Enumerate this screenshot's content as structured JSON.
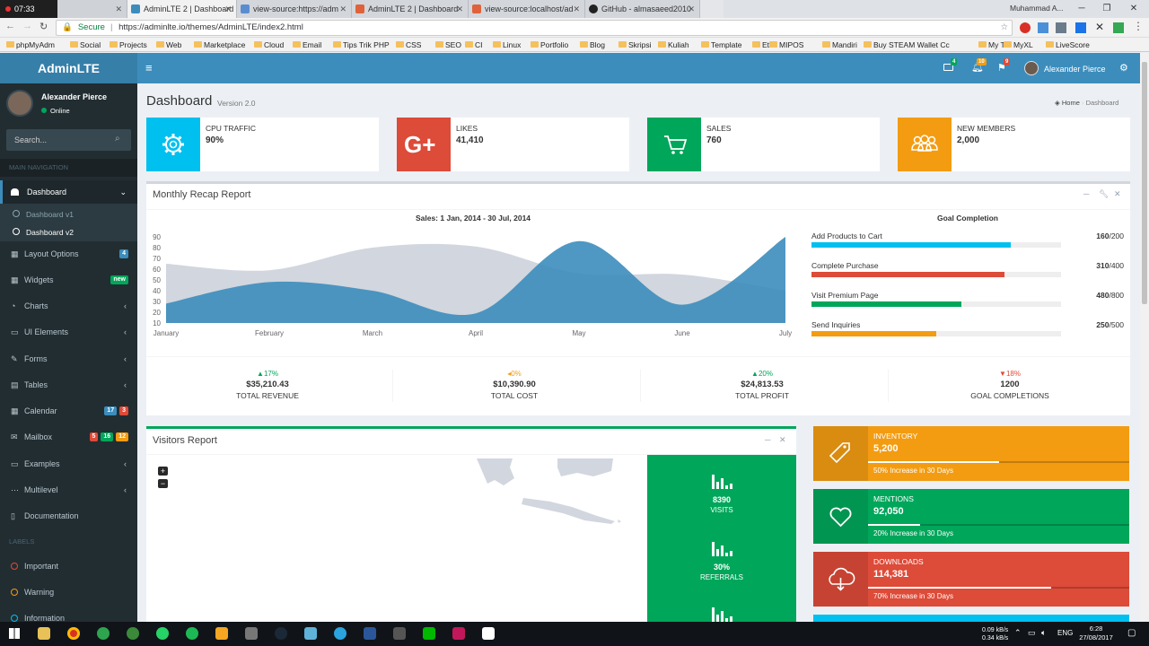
{
  "browser": {
    "clock": "07:33",
    "tabs": [
      {
        "title": "AdminLTE 2 | Dashboard",
        "active": true
      },
      {
        "title": "view-source:https://adm",
        "active": false
      },
      {
        "title": "AdminLTE 2 | Dashboard",
        "active": false
      },
      {
        "title": "view-source:localhost/ad",
        "active": false
      },
      {
        "title": "GitHub - almasaeed2010",
        "active": false
      }
    ],
    "user_chip": "Muhammad A...",
    "secure_label": "Secure",
    "url": "https://adminlte.io/themes/AdminLTE/index2.html",
    "bookmarks": [
      "phpMyAdm",
      "Social",
      "Projects",
      "Web",
      "Marketplace",
      "Cloud",
      "Email",
      "Tips Trik PHP",
      "CSS",
      "SEO",
      "CI",
      "Linux",
      "Portfolio",
      "Blog",
      "Skripsi",
      "Kuliah",
      "Template",
      "Etc",
      "MIPOS",
      "Mandiri",
      "Buy STEAM Wallet Cc",
      "My Tri",
      "MyXL",
      "LiveScore"
    ]
  },
  "header": {
    "logo": "AdminLTE",
    "user_name": "Alexander Pierce",
    "mail_count": "4",
    "notif_count": "10",
    "flag_count": "9"
  },
  "sidebar": {
    "user_name": "Alexander Pierce",
    "status": "Online",
    "search_placeholder": "Search...",
    "main_nav_header": "MAIN NAVIGATION",
    "dashboard": "Dashboard",
    "sub_v1": "Dashboard v1",
    "sub_v2": "Dashboard v2",
    "items": [
      {
        "label": "Layout Options",
        "badge": "4"
      },
      {
        "label": "Widgets",
        "badge": "new"
      },
      {
        "label": "Charts"
      },
      {
        "label": "UI Elements"
      },
      {
        "label": "Forms"
      },
      {
        "label": "Tables"
      },
      {
        "label": "Calendar",
        "badges": [
          "17",
          "3"
        ]
      },
      {
        "label": "Mailbox",
        "badges": [
          "5",
          "16",
          "12"
        ]
      },
      {
        "label": "Examples"
      },
      {
        "label": "Multilevel"
      },
      {
        "label": "Documentation"
      }
    ],
    "labels_header": "LABELS",
    "labels": [
      {
        "label": "Important",
        "color": "#dd4b39"
      },
      {
        "label": "Warning",
        "color": "#f39c12"
      },
      {
        "label": "Information",
        "color": "#00c0ef"
      }
    ]
  },
  "page": {
    "title": "Dashboard",
    "version": "Version 2.0",
    "breadcrumb_home": "Home",
    "breadcrumb_current": "Dashboard"
  },
  "info_boxes": [
    {
      "label": "CPU TRAFFIC",
      "value": "90%",
      "color": "#00c0ef"
    },
    {
      "label": "LIKES",
      "value": "41,410",
      "color": "#dd4b39"
    },
    {
      "label": "SALES",
      "value": "760",
      "color": "#00a65a"
    },
    {
      "label": "NEW MEMBERS",
      "value": "2,000",
      "color": "#f39c12"
    }
  ],
  "recap": {
    "title": "Monthly Recap Report",
    "goal_title": "Goal Completion",
    "goals": [
      {
        "label": "Add Products to Cart",
        "done": "160",
        "total": "/200",
        "color": "#00c0ef",
        "fraction": 0.8
      },
      {
        "label": "Complete Purchase",
        "done": "310",
        "total": "/400",
        "color": "#dd4b39",
        "fraction": 0.775
      },
      {
        "label": "Visit Premium Page",
        "done": "480",
        "total": "/800",
        "color": "#00a65a",
        "fraction": 0.6
      },
      {
        "label": "Send Inquiries",
        "done": "250",
        "total": "/500",
        "color": "#f39c12",
        "fraction": 0.5
      }
    ],
    "stats": [
      {
        "pct": "17%",
        "arrow": "▲",
        "color": "#00a65a",
        "amount": "$35,210.43",
        "caption": "TOTAL REVENUE"
      },
      {
        "pct": "0%",
        "arrow": "◂",
        "color": "#f39c12",
        "amount": "$10,390.90",
        "caption": "TOTAL COST"
      },
      {
        "pct": "20%",
        "arrow": "▲",
        "color": "#00a65a",
        "amount": "$24,813.53",
        "caption": "TOTAL PROFIT"
      },
      {
        "pct": "18%",
        "arrow": "▼",
        "color": "#dd4b39",
        "amount": "1200",
        "caption": "GOAL COMPLETIONS"
      }
    ]
  },
  "chart_data": {
    "type": "area",
    "title": "Sales: 1 Jan, 2014 - 30 Jul, 2014",
    "categories": [
      "January",
      "February",
      "March",
      "April",
      "May",
      "June",
      "July"
    ],
    "ylim": [
      10,
      90
    ],
    "yticks": [
      90,
      80,
      70,
      60,
      50,
      40,
      30,
      20,
      10
    ],
    "series": [
      {
        "values": [
          65,
          59,
          80,
          81,
          56,
          55,
          40
        ],
        "color": "#d2d6de"
      },
      {
        "values": [
          28,
          48,
          40,
          19,
          86,
          27,
          90
        ],
        "color": "#3c8dbc"
      }
    ]
  },
  "visitors": {
    "title": "Visitors Report",
    "zoom_in": "+",
    "zoom_out": "−",
    "stats": [
      {
        "value": "8390",
        "label": "VISITS"
      },
      {
        "value": "30%",
        "label": "REFERRALS"
      }
    ]
  },
  "side_boxes": [
    {
      "label": "INVENTORY",
      "value": "5,200",
      "desc": "50% Increase in 30 Days",
      "color": "#f39c12",
      "progress": 0.5
    },
    {
      "label": "MENTIONS",
      "value": "92,050",
      "desc": "20% Increase in 30 Days",
      "color": "#00a65a",
      "progress": 0.2
    },
    {
      "label": "DOWNLOADS",
      "value": "114,381",
      "desc": "70% Increase in 30 Days",
      "color": "#dd4b39",
      "progress": 0.7
    }
  ],
  "taskbar": {
    "net_up": "0.09 kB/s",
    "net_down": "0.34 kB/s",
    "lang": "ENG",
    "time": "6:28",
    "date": "27/08/2017"
  }
}
